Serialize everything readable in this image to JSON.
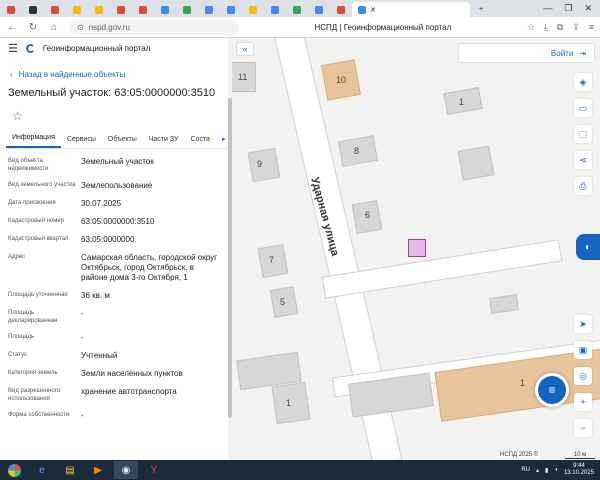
{
  "browser": {
    "url": "nspd.gov.ru",
    "page_title": "НСПД | Геоинформационный портал"
  },
  "panel": {
    "portal_title": "Геоинформационный портал",
    "back_label": "Назад в найденные объекты",
    "object_title": "Земельный участок: 63:05:0000000:3510",
    "tabs": [
      {
        "label": "Информация"
      },
      {
        "label": "Сервисы"
      },
      {
        "label": "Объекты"
      },
      {
        "label": "Части ЗУ"
      },
      {
        "label": "Соста"
      }
    ],
    "properties": [
      {
        "label": "Вид объекта недвижимости",
        "value": "Земельный участок"
      },
      {
        "label": "Вид земельного участка",
        "value": "Землепользование"
      },
      {
        "label": "Дата присвоения",
        "value": "30.07.2025"
      },
      {
        "label": "Кадастровый номер",
        "value": "63:05:0000000:3510"
      },
      {
        "label": "Кадастровый квартал",
        "value": "63:05:0000000"
      },
      {
        "label": "Адрес",
        "value": "Самарская область, городской округ Октябрьск, город Октябрьск, в районе дома 3-го Октября, 1"
      },
      {
        "label": "Площадь уточненная",
        "value": "36 кв. м"
      },
      {
        "label": "Площадь декларированная",
        "value": "-"
      },
      {
        "label": "Площадь",
        "value": "-"
      },
      {
        "label": "Статус",
        "value": "Учтенный"
      },
      {
        "label": "Категория земель",
        "value": "Земли населенных пунктов"
      },
      {
        "label": "Вид разрешенного использования",
        "value": "хранение автотранспорта"
      },
      {
        "label": "Форма собственности",
        "value": "-"
      }
    ]
  },
  "map": {
    "login_label": "Войти",
    "street_label": "Ударная улица",
    "building_numbers": [
      "11",
      "10",
      "1",
      "9",
      "8",
      "6",
      "7",
      "5",
      "1",
      "1"
    ],
    "copyright": "НСПД 2025 ©",
    "scale": "10 м"
  },
  "taskbar": {
    "lang": "RU",
    "time": "9:44",
    "date": "13.10.2025"
  },
  "colors": {
    "accent": "#1565c0",
    "parcel_fill": "#e8b8e8",
    "parcel_stroke": "#a040a0",
    "building_orange": "#e8c49a"
  }
}
